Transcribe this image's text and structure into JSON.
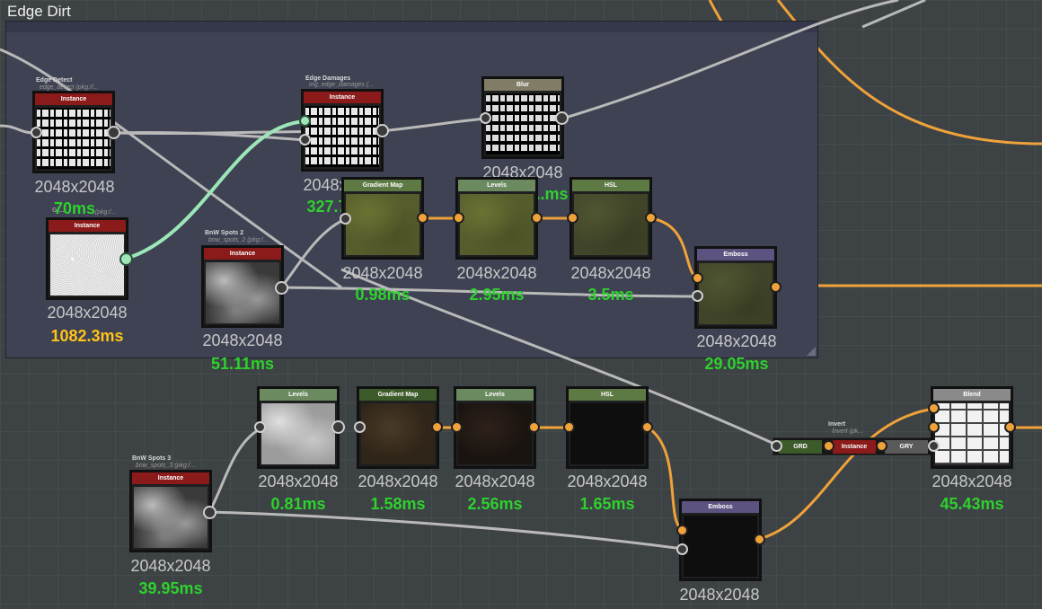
{
  "frame": {
    "title": "Edge Dirt"
  },
  "colors": {
    "instance": "#8b1a1a",
    "filter": "#5d7a44",
    "adjust": "#6b8a60",
    "blend": "#8a8a8a",
    "emboss": "#5d5380",
    "blur": "#807c65",
    "wire_orange": "#f0a23a",
    "wire_grey": "#b9b9b9",
    "wire_green": "#9ce6b8",
    "time_ok": "#2ed12e",
    "time_warn": "#ffc21a"
  },
  "nodes": {
    "edge_detect": {
      "caption": "Edge Detect",
      "subtitle": "edge_detect (pkg://...",
      "header": "Instance",
      "resolution": "2048x2048",
      "time": "70ms"
    },
    "noise": {
      "caption": "Gr...",
      "subtitle": "...(pkg:/...",
      "header": "Instance",
      "resolution": "2048x2048",
      "time": "1082.3ms"
    },
    "edge_damages": {
      "caption": "Edge Damages",
      "subtitle": "mg_edge_damages (...",
      "header": "Instance",
      "resolution": "2048x2048",
      "time": "327.74ms"
    },
    "blur": {
      "header": "Blur",
      "resolution": "2048x2048",
      "time": "...ms"
    },
    "bnw_spots_2": {
      "caption": "BnW Spots 2",
      "subtitle": "bnw_spots_2 (pkg:/...",
      "header": "Instance",
      "resolution": "2048x2048",
      "time": "51.11ms"
    },
    "gradient_map_1": {
      "header": "Gradient Map",
      "resolution": "2048x2048",
      "time": "0.98ms"
    },
    "levels_1": {
      "header": "Levels",
      "resolution": "2048x2048",
      "time": "2.95ms"
    },
    "hsl_1": {
      "header": "HSL",
      "resolution": "2048x2048",
      "time": "3.5ms"
    },
    "emboss_1": {
      "header": "Emboss",
      "resolution": "2048x2048",
      "time": "29.05ms"
    },
    "bnw_spots_3": {
      "caption": "BnW Spots 3",
      "subtitle": "bnw_spots_3 (pkg:/...",
      "header": "Instance",
      "resolution": "2048x2048",
      "time": "39.95ms"
    },
    "levels_2": {
      "header": "Levels",
      "resolution": "2048x2048",
      "time": "0.81ms"
    },
    "gradient_map_2": {
      "header": "Gradient Map",
      "resolution": "2048x2048",
      "time": "1.58ms"
    },
    "levels_3": {
      "header": "Levels",
      "resolution": "2048x2048",
      "time": "2.56ms"
    },
    "hsl_2": {
      "header": "HSL",
      "resolution": "2048x2048",
      "time": "1.65ms"
    },
    "emboss_2": {
      "header": "Emboss",
      "resolution": "2048x2048"
    },
    "blend": {
      "header": "Blend",
      "resolution": "2048x2048",
      "time": "45.43ms"
    },
    "invert": {
      "caption": "Invert",
      "subtitle": "Invert (pk...",
      "grd": "GRD",
      "instance": "Instance",
      "gry": "GRY"
    }
  }
}
